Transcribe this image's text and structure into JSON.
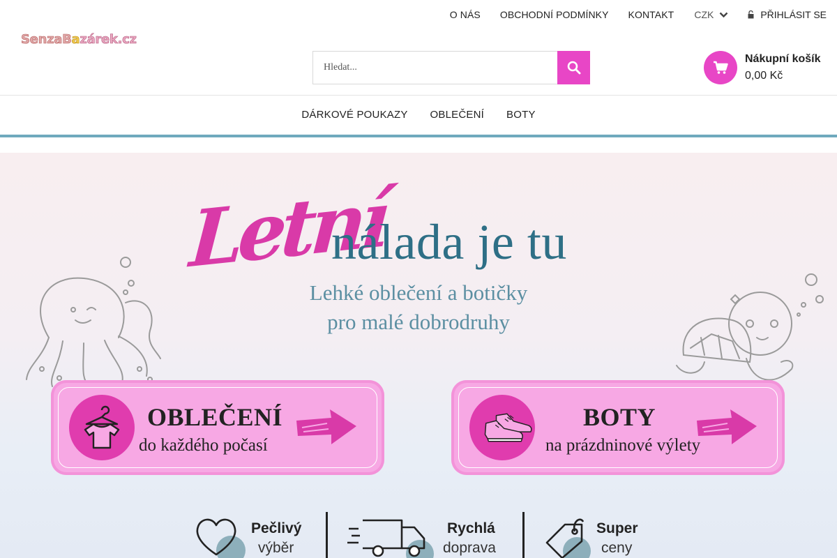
{
  "brand": {
    "logo_part1": "SenzaB",
    "logo_part2": "a",
    "logo_part3": "zárek.cz"
  },
  "topnav": {
    "about": "O NÁS",
    "terms": "OBCHODNÍ PODMÍNKY",
    "contact": "KONTAKT",
    "currency": "CZK",
    "login": "PŘIHLÁSIT SE"
  },
  "search": {
    "placeholder": "Hledat..."
  },
  "cart": {
    "title": "Nákupní košík",
    "price": "0,00 Kč"
  },
  "mainnav": {
    "items": [
      "DÁRKOVÉ POUKAZY",
      "OBLEČENÍ",
      "BOTY"
    ]
  },
  "banner": {
    "script_word": "Letní",
    "headline": "nálada je tu",
    "subline1": "Lehké oblečení a botičky",
    "subline2": "pro malé dobrodruhy",
    "cards": [
      {
        "title": "OBLEČENÍ",
        "subtitle": "do každého počasí",
        "icon": "tshirt-hanger-icon"
      },
      {
        "title": "BOTY",
        "subtitle": "na prázdninové výlety",
        "icon": "sneakers-icon"
      }
    ],
    "features": [
      {
        "title": "Pečlivý",
        "subtitle": "výběr",
        "icon": "heart-icon"
      },
      {
        "title": "Rychlá",
        "subtitle": "doprava",
        "icon": "truck-icon"
      },
      {
        "title": "Super",
        "subtitle": "ceny",
        "icon": "price-tag-icon"
      }
    ]
  },
  "colors": {
    "accent": "#e846c6",
    "headline": "#2e6f86",
    "rule": "#6fa9bd",
    "card": "#f7a8e4"
  }
}
